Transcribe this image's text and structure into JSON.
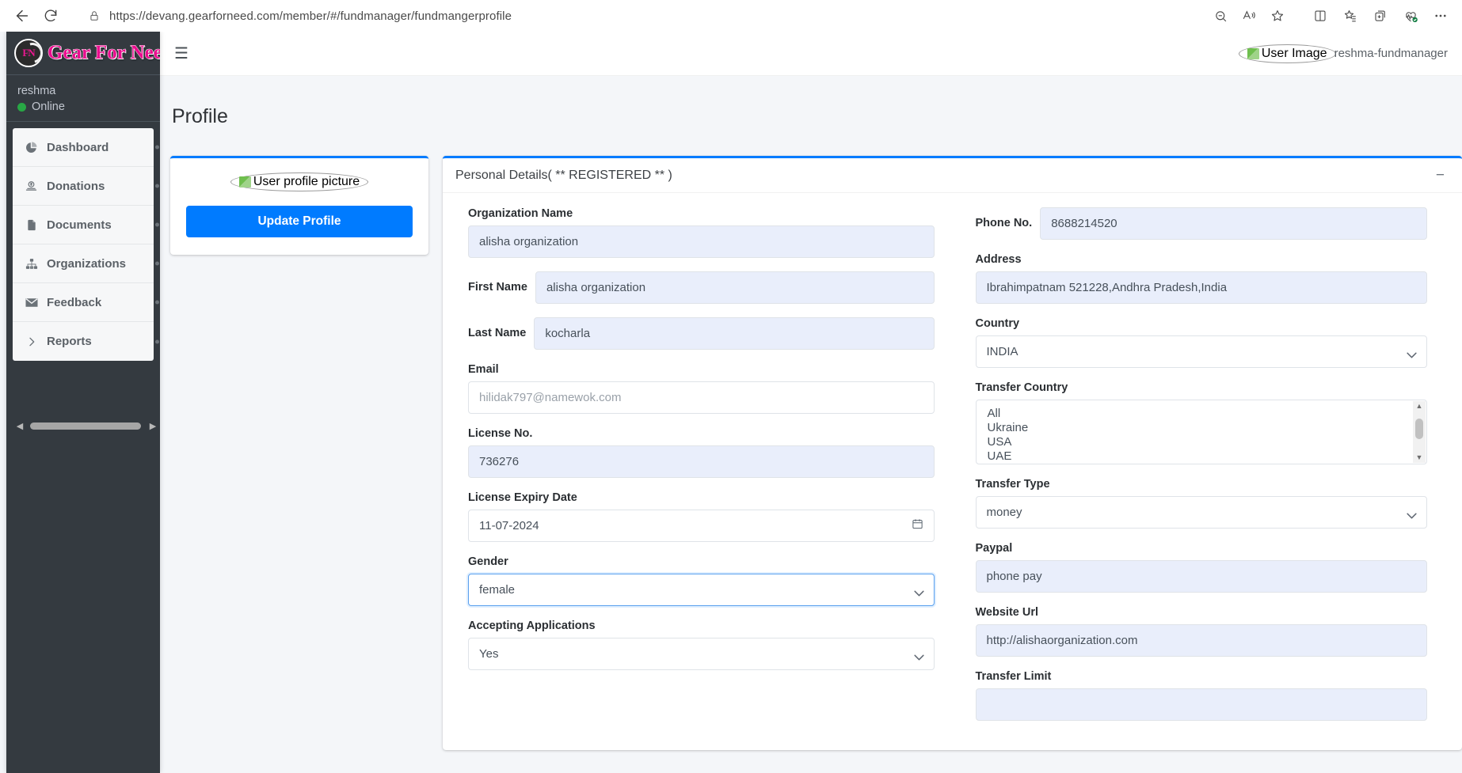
{
  "browser": {
    "back_label": "back-arrow",
    "reload_label": "reload",
    "url": "https://devang.gearforneed.com/member/#/fundmanager/fundmangerprofile",
    "lock_icon": "lock-icon",
    "omni_icons": [
      "zoom-out-icon",
      "read-aloud-icon",
      "favorite-star-icon"
    ],
    "toolbar_icons": [
      "split-screen-icon",
      "favorites-icon",
      "collections-icon",
      "browser-essentials-icon",
      "settings-more-icon"
    ]
  },
  "sidebar": {
    "brand": {
      "logo_text": "FN",
      "title": "Gear For Need"
    },
    "user": {
      "name": "reshma",
      "status": "Online"
    },
    "items": [
      {
        "label": "Dashboard",
        "icon": "pie-chart-icon"
      },
      {
        "label": "Donations",
        "icon": "donate-icon"
      },
      {
        "label": "Documents",
        "icon": "file-icon"
      },
      {
        "label": "Organizations",
        "icon": "sitemap-icon"
      },
      {
        "label": "Feedback",
        "icon": "envelope-icon"
      },
      {
        "label": "Reports",
        "icon": "chevron-right-icon"
      }
    ]
  },
  "topnav": {
    "hamburger": "☰",
    "user_image_alt": "User Image",
    "user_label": "reshma-fundmanager"
  },
  "main": {
    "page_title": "Profile",
    "profile_card": {
      "image_alt": "User profile picture",
      "update_button": "Update Profile"
    },
    "details_card": {
      "title": "Personal Details( ** REGISTERED ** )",
      "minimize": "−",
      "left_fields": [
        {
          "label": "Organization Name",
          "value": "alisha organization",
          "type": "text",
          "inline": false,
          "filled": true
        },
        {
          "label": "First Name",
          "value": "alisha organization",
          "type": "text",
          "inline": true,
          "filled": true
        },
        {
          "label": "Last Name",
          "value": "kocharla",
          "type": "text",
          "inline": true,
          "filled": true
        },
        {
          "label": "Email",
          "value": "",
          "placeholder": "hilidak797@namewok.com",
          "type": "text",
          "inline": false,
          "filled": false
        },
        {
          "label": "License No.",
          "value": "736276",
          "type": "text",
          "inline": false,
          "filled": true
        },
        {
          "label": "License Expiry Date",
          "value": "11-07-2024",
          "type": "date",
          "inline": false,
          "filled": false
        },
        {
          "label": "Gender",
          "value": "female",
          "type": "select",
          "inline": false,
          "filled": false,
          "focused": true
        },
        {
          "label": "Accepting Applications",
          "value": "Yes",
          "type": "select",
          "inline": false,
          "filled": false
        }
      ],
      "right_fields": [
        {
          "label": "Phone No.",
          "value": "8688214520",
          "type": "text",
          "inline": true,
          "filled": true
        },
        {
          "label": "Address",
          "value": "Ibrahimpatnam 521228,Andhra Pradesh,India",
          "type": "text",
          "inline": false,
          "filled": true
        },
        {
          "label": "Country",
          "value": "INDIA",
          "type": "select",
          "inline": false,
          "filled": false
        },
        {
          "label": "Transfer Country",
          "type": "listbox",
          "options": [
            "All",
            "Ukraine",
            "USA",
            "UAE"
          ]
        },
        {
          "label": "Transfer Type",
          "value": "money",
          "type": "select",
          "inline": false,
          "filled": false
        },
        {
          "label": "Paypal",
          "value": "phone pay",
          "type": "text",
          "inline": false,
          "filled": true
        },
        {
          "label": "Website Url",
          "value": "http://alishaorganization.com",
          "type": "text",
          "inline": false,
          "filled": true
        },
        {
          "label": "Transfer Limit",
          "value": "",
          "type": "text",
          "inline": false,
          "filled": true
        }
      ]
    }
  },
  "colors": {
    "accent": "#007bff",
    "sidebar_bg": "#343a40",
    "brand_pink": "#ea0d8e",
    "online_green": "#28a745",
    "input_filled": "#e9eefb"
  }
}
